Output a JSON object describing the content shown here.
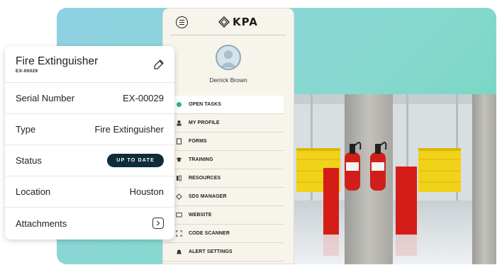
{
  "menu": {
    "brand": "KPA",
    "user_name": "Derrick Brown",
    "items": [
      {
        "label": "OPEN TASKS",
        "icon": "open-tasks-icon"
      },
      {
        "label": "MY PROFILE",
        "icon": "profile-icon"
      },
      {
        "label": "FORMS",
        "icon": "forms-icon"
      },
      {
        "label": "TRAINING",
        "icon": "training-icon"
      },
      {
        "label": "RESOURCES",
        "icon": "resources-icon"
      },
      {
        "label": "SDS MANAGER",
        "icon": "sds-manager-icon"
      },
      {
        "label": "WEBSITE",
        "icon": "website-icon"
      },
      {
        "label": "CODE SCANNER",
        "icon": "code-scanner-icon"
      },
      {
        "label": "ALERT SETTINGS",
        "icon": "bell-icon"
      }
    ]
  },
  "card": {
    "title": "Fire Extinguisher",
    "subtitle": "EX-00029",
    "rows": {
      "serial": {
        "label": "Serial Number",
        "value": "EX-00029"
      },
      "type": {
        "label": "Type",
        "value": "Fire Extinguisher"
      },
      "status": {
        "label": "Status",
        "value": "UP TO DATE"
      },
      "location": {
        "label": "Location",
        "value": "Houston"
      },
      "attachments": {
        "label": "Attachments"
      }
    }
  },
  "colors": {
    "badge": "#0f2c3a",
    "gradient_start": "#8fd1e3",
    "gradient_end": "#6fd3b9",
    "menu_bg": "#f7f4ec"
  }
}
